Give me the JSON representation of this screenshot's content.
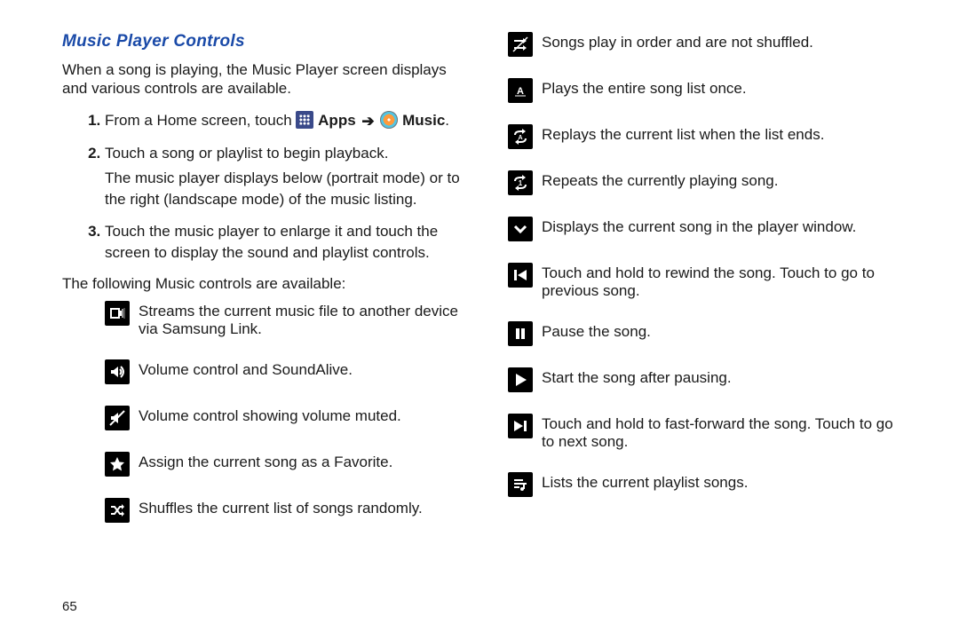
{
  "heading": "Music Player Controls",
  "intro": "When a song is playing, the Music Player screen displays and various controls are available.",
  "steps": [
    {
      "before": "From a Home screen, touch ",
      "apps": "Apps",
      "music": "Music",
      "arrow": "➔",
      "period": "."
    },
    {
      "main": "Touch a song or playlist to begin playback.",
      "sub": "The music player displays below (portrait mode) or to the right (landscape mode) of the music listing."
    },
    {
      "main": "Touch the music player to enlarge it and touch the screen to display the sound and playlist controls."
    }
  ],
  "controls_intro": "The following Music controls are available:",
  "controls_left": [
    {
      "icon": "stream",
      "desc": "Streams the current music file to another device via Samsung Link."
    },
    {
      "icon": "volume",
      "desc": "Volume control and SoundAlive."
    },
    {
      "icon": "muted",
      "desc": "Volume control showing volume muted."
    },
    {
      "icon": "star",
      "desc": "Assign the current song as a Favorite."
    },
    {
      "icon": "shuffle",
      "desc": "Shuffles the current list of songs randomly."
    }
  ],
  "controls_right": [
    {
      "icon": "straight",
      "desc": "Songs play in order and are not shuffled."
    },
    {
      "icon": "once",
      "desc": "Plays the entire song list once."
    },
    {
      "icon": "replay",
      "desc": "Replays the current list when the list ends."
    },
    {
      "icon": "repeat1",
      "desc": "Repeats the currently playing song."
    },
    {
      "icon": "chevdown",
      "desc": "Displays the current song in the player window."
    },
    {
      "icon": "prev",
      "desc": "Touch and hold to rewind the song. Touch to go to previous song."
    },
    {
      "icon": "pause",
      "desc": "Pause the song."
    },
    {
      "icon": "play",
      "desc": "Start the song after pausing."
    },
    {
      "icon": "next",
      "desc": "Touch and hold to fast-forward the song. Touch to go to next song."
    },
    {
      "icon": "listqueue",
      "desc": "Lists the current playlist songs."
    }
  ],
  "page_number": "65"
}
